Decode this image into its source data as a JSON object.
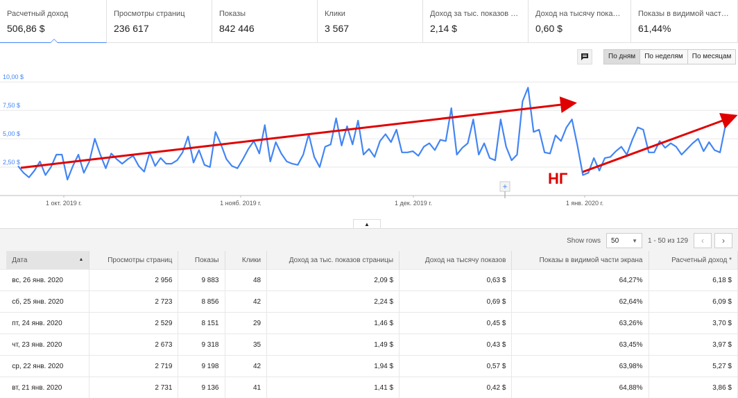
{
  "metrics": [
    {
      "label": "Расчетный доход",
      "value": "506,86 $"
    },
    {
      "label": "Просмотры страниц",
      "value": "236 617"
    },
    {
      "label": "Показы",
      "value": "842 446"
    },
    {
      "label": "Клики",
      "value": "3 567"
    },
    {
      "label": "Доход за тыс. показов ст...",
      "value": "2,14 $"
    },
    {
      "label": "Доход на тысячу показов",
      "value": "0,60 $"
    },
    {
      "label": "Показы в видимой части ...",
      "value": "61,44%"
    }
  ],
  "toolbar": {
    "annotation_icon": "comment-icon",
    "periods": [
      "По дням",
      "По неделям",
      "По месяцам"
    ],
    "selected_period": "По дням"
  },
  "chart_data": {
    "type": "line",
    "yticks": [
      "10,00 $",
      "7,50 $",
      "5,00 $",
      "2,50 $"
    ],
    "ylim": [
      0,
      10.5
    ],
    "xticks": [
      "1 окт. 2019 г.",
      "1 нояб. 2019 г.",
      "1 дек. 2019 г.",
      "1 янв. 2020 г."
    ],
    "annotation": "НГ",
    "colors": {
      "line": "#4285f4",
      "trend": "#e00000"
    },
    "values": [
      2.6,
      2.0,
      1.6,
      2.2,
      3.0,
      1.8,
      2.5,
      3.6,
      3.6,
      1.4,
      2.6,
      3.6,
      2.0,
      3.0,
      5.0,
      3.6,
      2.4,
      3.7,
      3.2,
      2.8,
      3.2,
      3.5,
      2.6,
      2.1,
      3.8,
      2.6,
      3.3,
      2.8,
      2.8,
      3.1,
      3.8,
      5.2,
      2.9,
      4.0,
      2.7,
      2.5,
      5.6,
      4.5,
      3.2,
      2.6,
      2.4,
      3.2,
      4.1,
      4.8,
      3.7,
      6.2,
      3.0,
      4.7,
      3.7,
      3.0,
      2.8,
      2.7,
      3.6,
      5.4,
      3.4,
      2.5,
      4.3,
      4.5,
      6.8,
      4.4,
      6.1,
      4.5,
      6.6,
      3.6,
      4.1,
      3.4,
      4.8,
      5.4,
      4.7,
      5.8,
      3.8,
      3.8,
      3.9,
      3.5,
      4.3,
      4.6,
      4.0,
      4.9,
      4.8,
      7.7,
      3.6,
      4.2,
      4.6,
      6.7,
      3.6,
      4.6,
      3.3,
      3.1,
      6.7,
      4.3,
      3.1,
      3.6,
      8.3,
      9.5,
      5.6,
      5.8,
      3.8,
      3.7,
      5.3,
      4.8,
      6.0,
      6.7,
      4.4,
      1.8,
      2.0,
      3.3,
      2.2,
      3.3,
      3.4,
      3.9,
      4.3,
      3.6,
      4.9,
      6.0,
      5.8,
      3.8,
      3.8,
      4.8,
      4.2,
      4.6,
      4.3,
      3.6,
      4.1,
      4.6,
      5.0,
      3.9,
      4.7,
      4.0,
      3.8,
      6.2
    ]
  },
  "table": {
    "show_rows_label": "Show rows",
    "rows_per_page": "50",
    "range": "1 - 50 из 129",
    "columns": [
      "Дата",
      "Просмотры страниц",
      "Показы",
      "Клики",
      "Доход за тыс. показов страницы",
      "Доход на тысячу показов",
      "Показы в видимой части экрана",
      "Расчетный доход *"
    ],
    "rows": [
      [
        "вс, 26 янв. 2020",
        "2 956",
        "9 883",
        "48",
        "2,09 $",
        "0,63 $",
        "64,27%",
        "6,18 $"
      ],
      [
        "сб, 25 янв. 2020",
        "2 723",
        "8 856",
        "42",
        "2,24 $",
        "0,69 $",
        "62,64%",
        "6,09 $"
      ],
      [
        "пт, 24 янв. 2020",
        "2 529",
        "8 151",
        "29",
        "1,46 $",
        "0,45 $",
        "63,26%",
        "3,70 $"
      ],
      [
        "чт, 23 янв. 2020",
        "2 673",
        "9 318",
        "35",
        "1,49 $",
        "0,43 $",
        "63,45%",
        "3,97 $"
      ],
      [
        "ср, 22 янв. 2020",
        "2 719",
        "9 198",
        "42",
        "1,94 $",
        "0,57 $",
        "63,98%",
        "5,27 $"
      ],
      [
        "вт, 21 янв. 2020",
        "2 731",
        "9 136",
        "41",
        "1,41 $",
        "0,42 $",
        "64,88%",
        "3,86 $"
      ]
    ]
  }
}
